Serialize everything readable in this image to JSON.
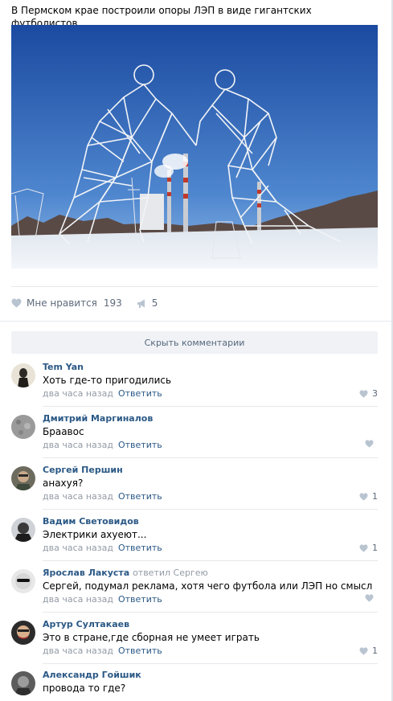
{
  "post": {
    "text": "В Пермском крае построили опоры ЛЭП в виде гигантских футболистов.",
    "photo_icon": "photo-power-pylons"
  },
  "actions": {
    "like_label": "Мне нравится",
    "like_count": "193",
    "share_count": "5",
    "like_icon": "heart-icon",
    "share_icon": "megaphone-icon"
  },
  "hide_comments_label": "Скрыть комментарии",
  "comments": [
    {
      "author": "Tem Yan",
      "reply_to": "",
      "text": "Хоть где-то пригодились",
      "time": "два часа назад",
      "reply_label": "Ответить",
      "likes": "3"
    },
    {
      "author": "Дмитрий Маргиналов",
      "reply_to": "",
      "text": "Браавос",
      "time": "два часа назад",
      "reply_label": "Ответить",
      "likes": ""
    },
    {
      "author": "Сергей Першин",
      "reply_to": "",
      "text": "анахуя?",
      "time": "два часа назад",
      "reply_label": "Ответить",
      "likes": "1"
    },
    {
      "author": "Вадим Световидов",
      "reply_to": "",
      "text": "Электрики ахуеют...",
      "time": "два часа назад",
      "reply_label": "Ответить",
      "likes": "1"
    },
    {
      "author": "Ярослав Лакуста",
      "reply_to": "ответил Сергею",
      "text": "Сергей, подумал реклама, хотя чего футбола или ЛЭП но смысл",
      "time": "два часа назад",
      "reply_label": "Ответить",
      "likes": ""
    },
    {
      "author": "Артур Султакаев",
      "reply_to": "",
      "text": "Это в стране,где сборная не умеет играть",
      "time": "два часа назад",
      "reply_label": "Ответить",
      "likes": "1"
    },
    {
      "author": "Александр Гойшик",
      "reply_to": "",
      "text": "провода то где?",
      "time": "",
      "reply_label": "",
      "likes": ""
    }
  ],
  "colors": {
    "link": "#2a5885",
    "muted": "#939ba5",
    "button_bg": "#f0f2f5",
    "sky_top": "#1e4fa6",
    "sky_bottom": "#5f97d8"
  }
}
